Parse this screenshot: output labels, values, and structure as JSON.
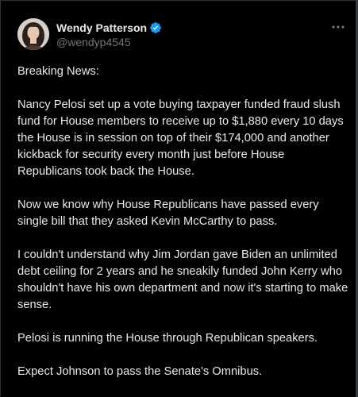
{
  "author": {
    "display_name": "Wendy Patterson",
    "handle": "@wendyp4545",
    "verified": true,
    "avatar_icon": "user-avatar"
  },
  "colors": {
    "background": "#000000",
    "text": "#e7e9ea",
    "muted": "#71767b",
    "verified_badge": "#1d9bf0",
    "border": "#2f3336"
  },
  "post": {
    "paragraphs": [
      "Breaking News:",
      "Nancy Pelosi set up a vote buying taxpayer funded fraud slush fund for House members to receive up to $1,880 every 10 days the House is in session on top of their $174,000 and another kickback for security every month just before House Republicans took back the House.",
      "Now we know why House Republicans have passed every single bill that they asked Kevin McCarthy to pass.",
      "I couldn't understand why Jim Jordan gave Biden an unlimited debt ceiling for 2 years and he sneakily funded John Kerry who shouldn't have his own department and now it's starting to make sense.",
      "Pelosi is running the House through Republican speakers.",
      "Expect Johnson to pass the Senate's Omnibus."
    ]
  },
  "more_icon": "more-horizontal-icon"
}
